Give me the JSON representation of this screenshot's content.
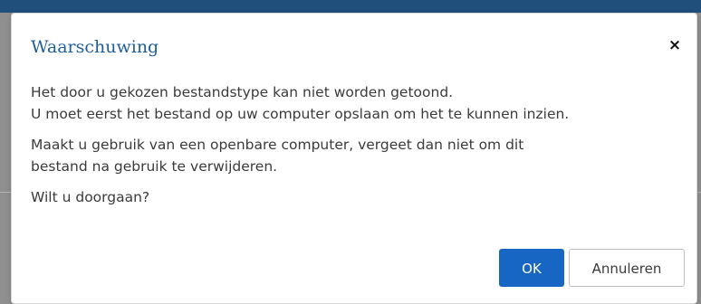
{
  "dialog": {
    "title": "Waarschuwing",
    "close_label": "×",
    "paragraphs": [
      {
        "line1": "Het door u gekozen bestandstype kan niet worden getoond.",
        "line2": "U moet eerst het bestand op uw computer opslaan om het te kunnen inzien."
      },
      {
        "line1": "Maakt u gebruik van een openbare computer, vergeet dan niet om dit",
        "line2": "bestand na gebruik te verwijderen."
      },
      {
        "line1": "Wilt u doorgaan?"
      }
    ],
    "ok_label": "OK",
    "cancel_label": "Annuleren"
  },
  "colors": {
    "title": "#1f5f99",
    "primary_button": "#1766c4",
    "header_bar": "#1f4f7a"
  },
  "icons": {
    "close": "close-icon"
  }
}
